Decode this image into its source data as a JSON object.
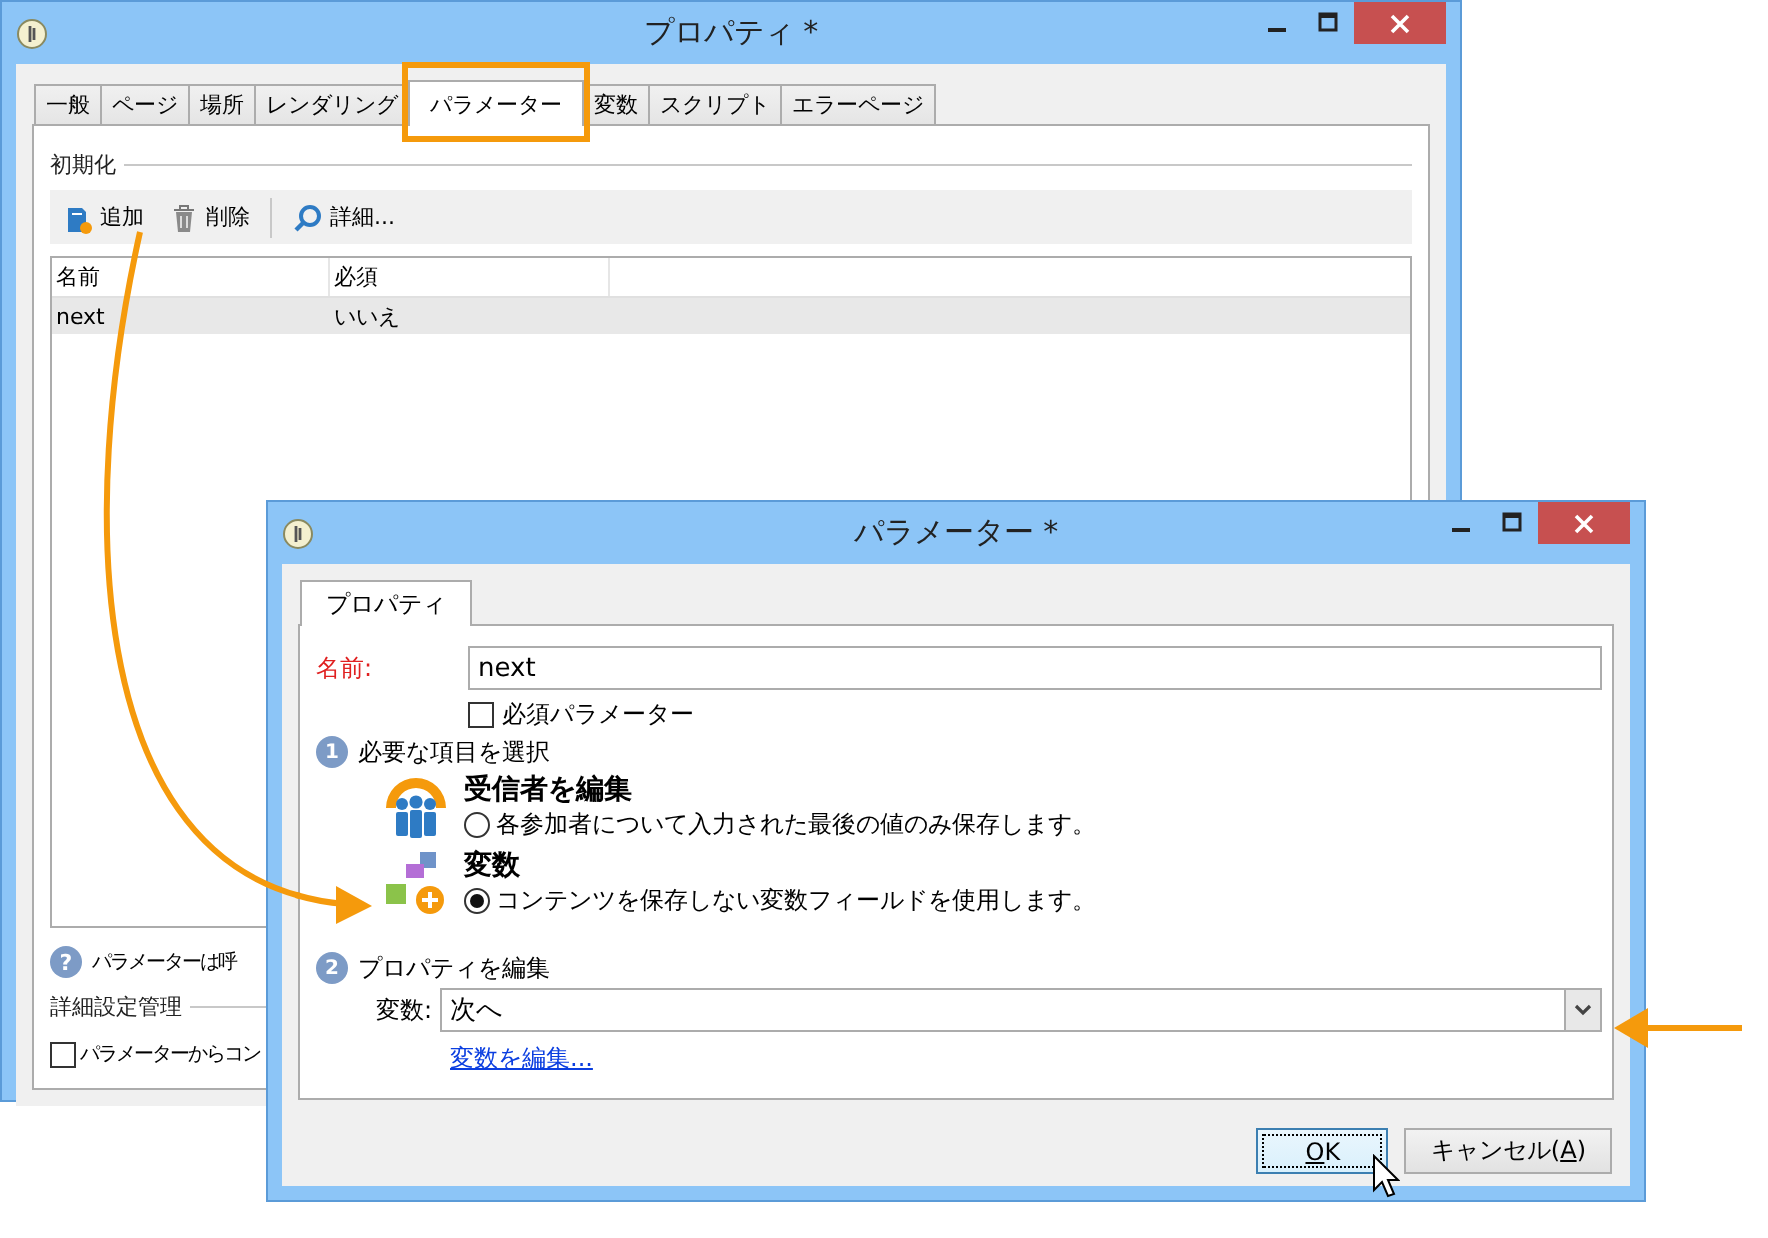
{
  "back_window": {
    "title": "プロパティ *",
    "tabs": [
      {
        "label": "一般",
        "selected": false
      },
      {
        "label": "ページ",
        "selected": false
      },
      {
        "label": "場所",
        "selected": false
      },
      {
        "label": "レンダリング",
        "selected": false
      },
      {
        "label": "パラメーター",
        "selected": true
      },
      {
        "label": "変数",
        "selected": false
      },
      {
        "label": "スクリプト",
        "selected": false
      },
      {
        "label": "エラーページ",
        "selected": false
      }
    ],
    "section_title": "初期化",
    "toolbar": [
      {
        "kind": "add",
        "label": "追加"
      },
      {
        "kind": "delete",
        "label": "削除"
      },
      {
        "kind": "details",
        "label": "詳細..."
      }
    ],
    "table": {
      "columns": [
        "名前",
        "必須"
      ],
      "rows": [
        {
          "cells": [
            "next",
            "いいえ"
          ],
          "selected": true
        }
      ]
    },
    "help_icon": "?",
    "help_text": "パラメーターは呼",
    "advanced_title": "詳細設定管理",
    "advanced_checkbox": {
      "label": "パラメーターからコン",
      "checked": false
    }
  },
  "front_window": {
    "title": "パラメーター *",
    "tabs": [
      {
        "label": "プロパティ",
        "selected": true
      }
    ],
    "name_label": "名前:",
    "name_value": "next",
    "required_checkbox": {
      "label": "必須パラメーター",
      "checked": false
    },
    "step1": {
      "number": "1",
      "label": "必要な項目を選択"
    },
    "options": [
      {
        "kind": "recipients",
        "title": "受信者を編集",
        "description": "各参加者について入力された最後の値のみ保存します。",
        "selected": false
      },
      {
        "kind": "variable",
        "title": "変数",
        "description": "コンテンツを保存しない変数フィールドを使用します。",
        "selected": true
      }
    ],
    "step2": {
      "number": "2",
      "label": "プロパティを編集"
    },
    "variable_label": "変数:",
    "variable_value": "次へ",
    "edit_link": "変数を編集...",
    "buttons": [
      {
        "key": "O",
        "after": "K",
        "default": true
      },
      {
        "before": "キャンセル(",
        "key": "A",
        "after": ")",
        "default": false
      }
    ]
  }
}
